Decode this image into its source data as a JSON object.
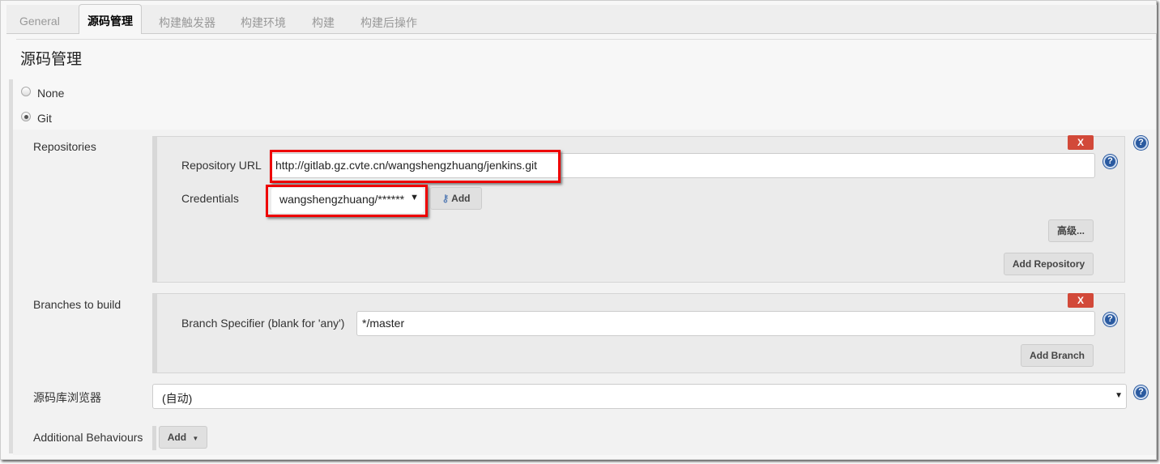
{
  "tabs": [
    {
      "label": "General"
    },
    {
      "label": "源码管理",
      "active": true
    },
    {
      "label": "构建触发器"
    },
    {
      "label": "构建环境"
    },
    {
      "label": "构建"
    },
    {
      "label": "构建后操作"
    }
  ],
  "section_title": "源码管理",
  "scm": {
    "options": [
      {
        "label": "None",
        "selected": false
      },
      {
        "label": "Git",
        "selected": true
      }
    ]
  },
  "repositories": {
    "label": "Repositories",
    "delete_label": "X",
    "url_label": "Repository URL",
    "url_value": "http://gitlab.gz.cvte.cn/wangshengzhuang/jenkins.git",
    "credentials_label": "Credentials",
    "credentials_value": "wangshengzhuang/******",
    "add_label": "Add",
    "advanced_label": "高级...",
    "add_repository_label": "Add Repository"
  },
  "branches": {
    "label": "Branches to build",
    "delete_label": "X",
    "specifier_label": "Branch Specifier (blank for 'any')",
    "specifier_value": "*/master",
    "add_branch_label": "Add Branch"
  },
  "browser": {
    "label": "源码库浏览器",
    "value": "(自动)"
  },
  "behaviours": {
    "label": "Additional Behaviours",
    "add_label": "Add"
  },
  "help_symbol": "?",
  "colors": {
    "delete": "#d24939",
    "highlight": "#e00000",
    "help": "#2a5aa0"
  }
}
